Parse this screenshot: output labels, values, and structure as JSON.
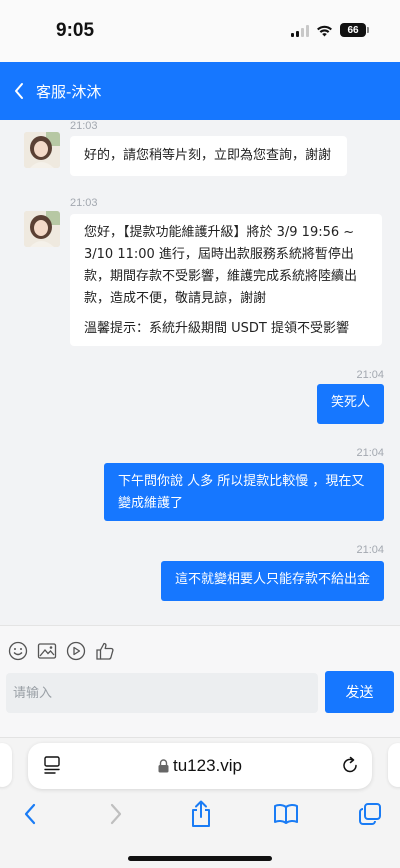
{
  "status_bar": {
    "time": "9:05",
    "battery": "66"
  },
  "header": {
    "title": "客服-沐沐"
  },
  "messages": [
    {
      "from": "agent",
      "time": "21:03",
      "lines": [
        "好的，請您稍等片刻，立即為您查詢，謝謝"
      ]
    },
    {
      "from": "agent",
      "time": "21:03",
      "lines": [
        "您好，【提款功能維護升級】將於 3/9 19:56 ~",
        "3/10 11:00 進行，屆時出款服務系統將暫停出",
        "款，期間存款不受影響，維護完成系統將陸續出",
        "款，造成不便，敬請見諒，謝謝",
        "",
        "溫馨提示：系統升級期間 USDT 提領不受影響"
      ]
    },
    {
      "from": "user",
      "time": "21:04",
      "lines": [
        "笑死人"
      ]
    },
    {
      "from": "user",
      "time": "21:04",
      "lines": [
        "下午問你說 人多 所以提款比較慢 ，現在又",
        "變成維護了"
      ]
    },
    {
      "from": "user",
      "time": "21:04",
      "lines": [
        "這不就變相要人只能存款不給出金"
      ]
    }
  ],
  "composer": {
    "placeholder": "请输入",
    "send_label": "发送",
    "tools": [
      "emoji-icon",
      "image-icon",
      "video-icon",
      "thumbs-up-icon"
    ]
  },
  "browser": {
    "domain": "tu123.vip"
  },
  "colors": {
    "brand": "#1677ff",
    "background": "#f2f3f5"
  }
}
